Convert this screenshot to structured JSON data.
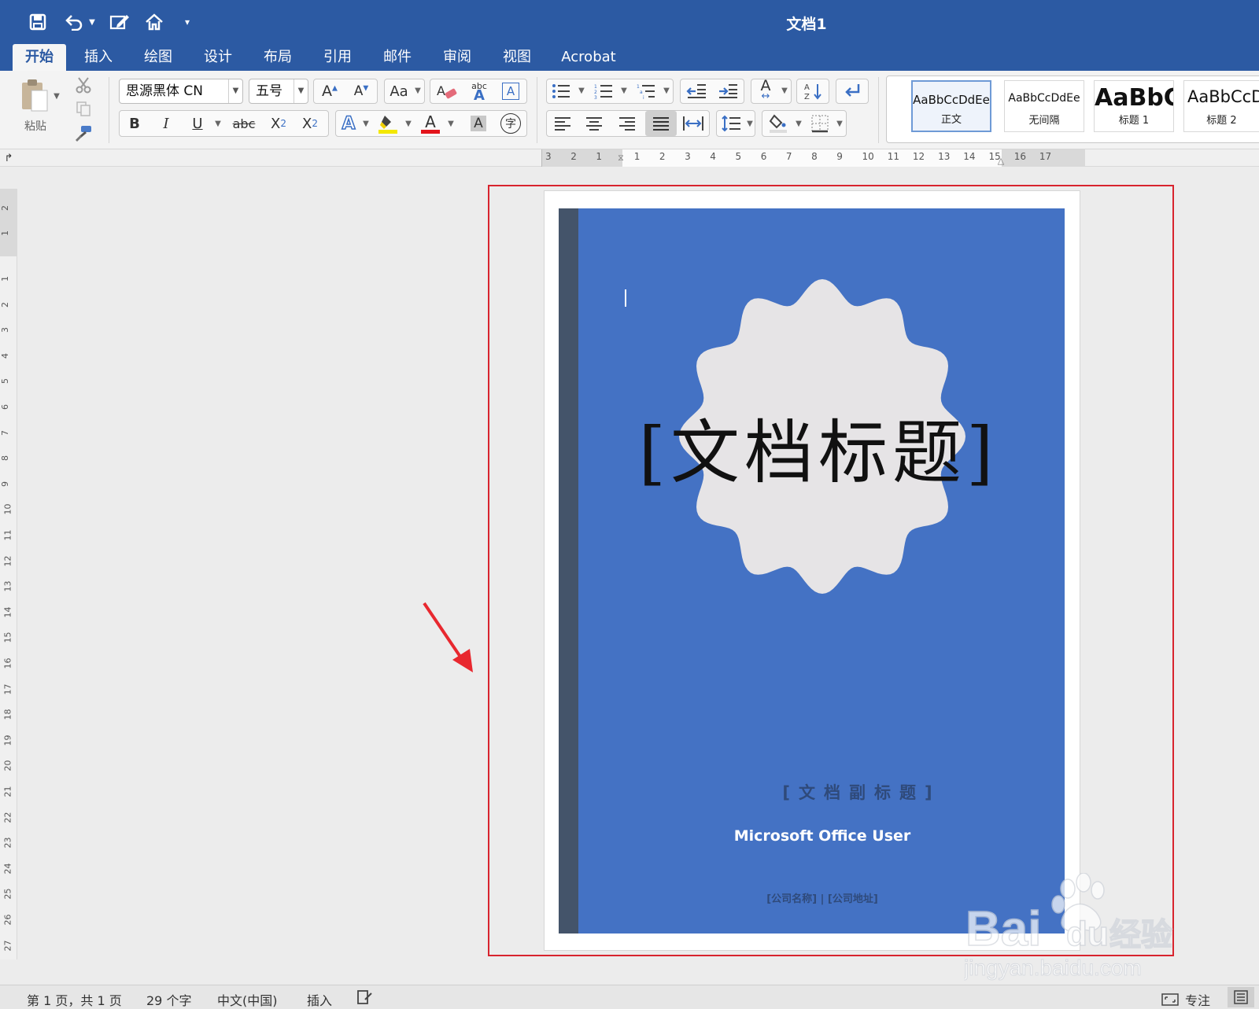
{
  "window": {
    "title": "文档1"
  },
  "quick_access": {
    "icons": [
      "save-icon",
      "undo-icon",
      "chevron-down-icon",
      "edit-document-icon",
      "home-icon",
      "customize-icon"
    ]
  },
  "tabs": [
    "开始",
    "插入",
    "绘图",
    "设计",
    "布局",
    "引用",
    "邮件",
    "审阅",
    "视图",
    "Acrobat"
  ],
  "ribbon": {
    "clipboard": {
      "paste_label": "粘贴"
    },
    "font": {
      "name": "思源黑体 CN",
      "size": "五号",
      "bold": "B",
      "italic": "I",
      "underline": "U",
      "strikethrough": "abc",
      "subscript": "X",
      "subscript_mark": "2",
      "superscript": "X",
      "superscript_mark": "2",
      "phonetic": "abc",
      "enclose": "字"
    },
    "styles": [
      {
        "preview": "AaBbCcDdEe",
        "name": "正文",
        "selected": true
      },
      {
        "preview": "AaBbCcDdEe",
        "name": "无间隔",
        "selected": false
      },
      {
        "preview": "AaBbC",
        "name": "标题 1",
        "selected": false
      },
      {
        "preview": "AaBbCcD",
        "name": "标题 2",
        "selected": false
      }
    ]
  },
  "ruler": {
    "horizontal": [
      "3",
      "2",
      "1",
      "1",
      "2",
      "3",
      "4",
      "5",
      "6",
      "7",
      "8",
      "9",
      "10",
      "11",
      "12",
      "13",
      "14",
      "15",
      "16",
      "17"
    ],
    "vertical": [
      "2",
      "1",
      "1",
      "2",
      "3",
      "4",
      "5",
      "6",
      "7",
      "8",
      "9",
      "10",
      "11",
      "12",
      "13",
      "14",
      "15",
      "16",
      "17",
      "18",
      "19",
      "20",
      "21",
      "22",
      "23",
      "24",
      "25",
      "26",
      "27"
    ]
  },
  "cover": {
    "title": "[文档标题]",
    "subtitle": "[文档副标题]",
    "author": "Microsoft Office User",
    "company": "[公司名称] | [公司地址]"
  },
  "status": {
    "page": "第 1 页，共 1 页",
    "words": "29 个字",
    "language": "中文(中国)",
    "mode": "插入",
    "focus": "专注"
  },
  "watermark": {
    "brand": "Bai",
    "brand_tail": "du",
    "cn": "经验",
    "url": "jingyan.baidu.com"
  },
  "colors": {
    "titlebar": "#2c5aa3",
    "cover_blue": "#4472c4",
    "cover_sidebar": "#44546a",
    "badge": "#e6e4e6",
    "highlight_red": "#d8242e"
  }
}
